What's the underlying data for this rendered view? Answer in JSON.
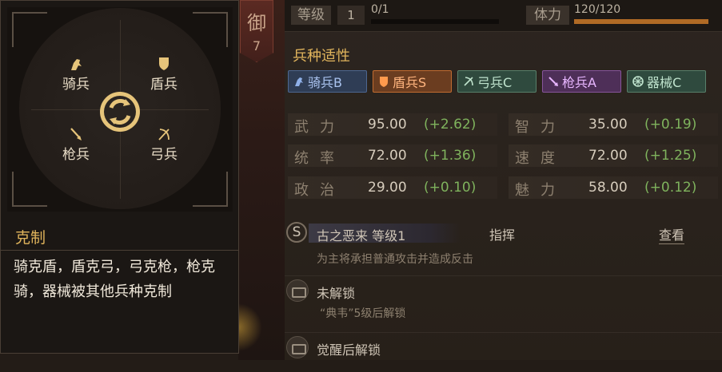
{
  "hero_tag": {
    "char": "御",
    "number": "7"
  },
  "top": {
    "level_label": "等级",
    "level_value": "1",
    "exp_text": "0/1",
    "exp_fraction": 0.0,
    "stamina_label": "体力",
    "stamina_text": "120/120",
    "stamina_fraction": 1.0
  },
  "aptitude": {
    "title": "兵种适性",
    "troops": [
      {
        "label": "骑兵B",
        "icon": "horse-icon"
      },
      {
        "label": "盾兵S",
        "icon": "shield-icon"
      },
      {
        "label": "弓兵C",
        "icon": "bow-icon"
      },
      {
        "label": "枪兵A",
        "icon": "spear-icon"
      },
      {
        "label": "器械C",
        "icon": "gear-wheel-icon"
      }
    ]
  },
  "stats": [
    {
      "name": "武力",
      "value": "95.00",
      "bonus": "(+2.62)"
    },
    {
      "name": "智力",
      "value": "35.00",
      "bonus": "(+0.19)"
    },
    {
      "name": "统率",
      "value": "72.00",
      "bonus": "(+1.36)"
    },
    {
      "name": "速度",
      "value": "72.00",
      "bonus": "(+1.25)"
    },
    {
      "name": "政治",
      "value": "29.00",
      "bonus": "(+0.10)"
    },
    {
      "name": "魅力",
      "value": "58.00",
      "bonus": "(+0.12)"
    }
  ],
  "skill": {
    "grade": "S",
    "name": "古之恶来 等级1",
    "type": "指挥",
    "view": "查看",
    "desc": "为主将承担普通攻击并造成反击"
  },
  "locked": [
    {
      "title": "未解锁",
      "desc": "“典韦”5级后解锁"
    },
    {
      "title": "觉醒后解锁",
      "desc": ""
    }
  ],
  "popup": {
    "units": {
      "cavalry": "骑兵",
      "shield": "盾兵",
      "spear": "枪兵",
      "bow": "弓兵"
    },
    "counter_title": "克制",
    "counter_text": "骑克盾，盾克弓，弓克枪，枪克骑，器械被其他兵种克制"
  }
}
